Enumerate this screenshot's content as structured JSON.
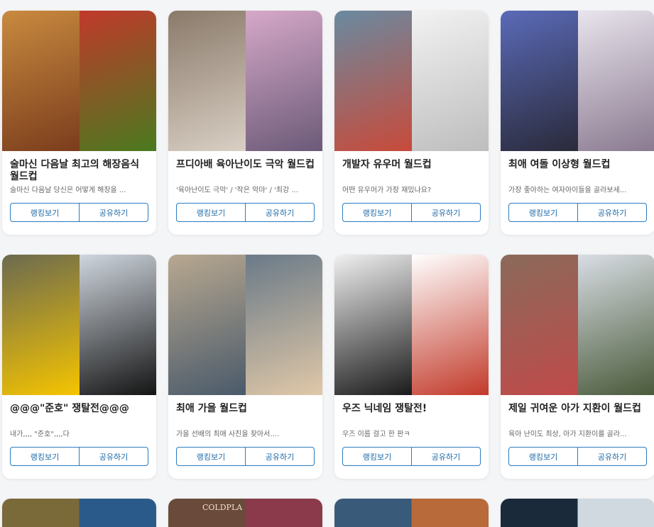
{
  "cards": [
    {
      "title": "술마신 다음날 최고의 해장음식 월드컵",
      "desc": "술마신 다음날 당신은 어떻게 해장을 ...",
      "rank_label": "랭킹보기",
      "share_label": "공유하기",
      "images": [
        {
          "alt": "hamburger",
          "c1": "#c98a3f",
          "c2": "#7a3d1c"
        },
        {
          "alt": "spicy stew",
          "c1": "#c0392b",
          "c2": "#4a7a1f"
        }
      ]
    },
    {
      "title": "프디아배 육아난이도 극악 월드컵",
      "desc": "'육아난이도 극악' / '작은 악마' / '최강 ...",
      "rank_label": "랭킹보기",
      "share_label": "공유하기",
      "images": [
        {
          "alt": "child photo",
          "c1": "#8a7a6a",
          "c2": "#d9cfc4"
        },
        {
          "alt": "child in pink",
          "c1": "#d6a8c8",
          "c2": "#6b5a78"
        }
      ]
    },
    {
      "title": "개발자 유우머 월드컵",
      "desc": "어떤 유우머가 가장 재밌나요?",
      "rank_label": "랭킹보기",
      "share_label": "공유하기",
      "images": [
        {
          "alt": "framework meme",
          "c1": "#6a8aa0",
          "c2": "#c84a3a"
        },
        {
          "alt": "rage comic",
          "c1": "#f2f2f2",
          "c2": "#bdbdbd"
        }
      ]
    },
    {
      "title": "최애 여돌 이상형 월드컵",
      "desc": "가장 좋아하는 여자아이들을 골라보세...",
      "rank_label": "랭킹보기",
      "share_label": "공유하기",
      "images": [
        {
          "alt": "idol group",
          "c1": "#5a6ab8",
          "c2": "#2a2a3a"
        },
        {
          "alt": "idol group",
          "c1": "#e8e4ec",
          "c2": "#8a7a90"
        }
      ]
    },
    {
      "title": "@@@\"준호\" 쟁탈전@@@",
      "desc": "내가,,,, \"준호\",,,,다",
      "rank_label": "랭킹보기",
      "share_label": "공유하기",
      "images": [
        {
          "alt": "soldier with smiley",
          "c1": "#6b6a50",
          "c2": "#f5c400"
        },
        {
          "alt": "man in black",
          "c1": "#cfd6de",
          "c2": "#141414"
        }
      ]
    },
    {
      "title": "최애 가을 월드컵",
      "desc": "가을 선배의 최애 사진을 찾아서....",
      "rank_label": "랭킹보기",
      "share_label": "공유하기",
      "images": [
        {
          "alt": "woman portrait",
          "c1": "#b8a890",
          "c2": "#4a5a6a"
        },
        {
          "alt": "woman at stadium",
          "c1": "#6a7a88",
          "c2": "#e0c8a8"
        }
      ]
    },
    {
      "title": "우즈 닉네임 쟁탈전!",
      "desc": "우즈 이름 걸고 한 판ㅋ",
      "rank_label": "랭킹보기",
      "share_label": "공유하기",
      "images": [
        {
          "alt": "gamer portrait",
          "c1": "#f0f0f0",
          "c2": "#1a1a1a"
        },
        {
          "alt": "baseball player",
          "c1": "#ffffff",
          "c2": "#c23a2a"
        }
      ]
    },
    {
      "title": "제일 귀여운 아가 지환이 월드컵",
      "desc": "육아 난이도 최상, 아가 지환이를 골라...",
      "rank_label": "랭킹보기",
      "share_label": "공유하기",
      "images": [
        {
          "alt": "baby in red",
          "c1": "#8a6a5a",
          "c2": "#c04a4a"
        },
        {
          "alt": "child in snow",
          "c1": "#d8dde4",
          "c2": "#4a5a3a"
        }
      ]
    }
  ],
  "partial_cards": [
    {
      "images": [
        {
          "alt": "food",
          "c1": "#7a6a3a",
          "c2": "#2a5a8a"
        }
      ]
    },
    {
      "images": [
        {
          "alt": "coldplay",
          "c1": "#6a4a3a",
          "c2": "#8a3a4a"
        }
      ],
      "text": "COLDPLA"
    },
    {
      "images": [
        {
          "alt": "game art",
          "c1": "#3a5a7a",
          "c2": "#b86a3a"
        }
      ]
    },
    {
      "images": [
        {
          "alt": "anime art",
          "c1": "#1a2a3a",
          "c2": "#d0d8e0"
        }
      ]
    }
  ]
}
